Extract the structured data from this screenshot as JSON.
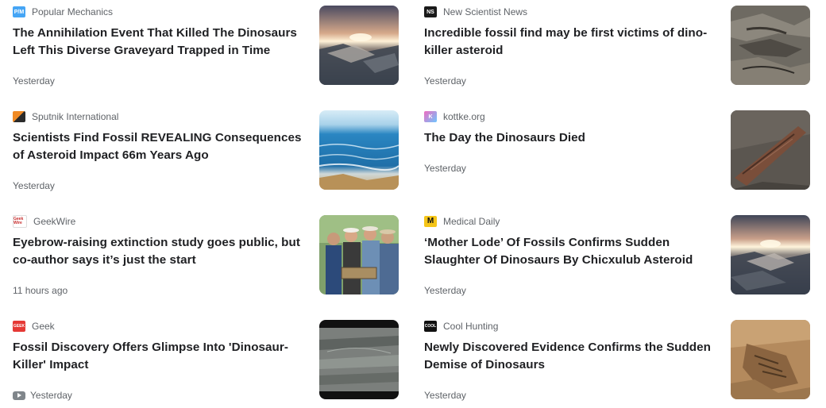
{
  "articles": [
    {
      "source": "Popular Mechanics",
      "logo_text": "P/M",
      "logo_color": "#45a5f5",
      "title": "The Annihilation Event That Killed The Dinosaurs Left This Diverse Graveyard Trapped in Time",
      "time": "Yesterday",
      "thumb": "sunset-ruins-thumbnail"
    },
    {
      "source": "New Scientist News",
      "logo_text": "NS",
      "logo_color": "#1a1a1a",
      "title": "Incredible fossil find may be first victims of dino-killer asteroid",
      "time": "Yesterday",
      "thumb": "fossil-fish-thumbnail"
    },
    {
      "source": "Sputnik International",
      "logo_text": "",
      "logo_color": "#e8622a",
      "title": "Scientists Find Fossil REVEALING Consequences of Asteroid Impact 66m Years Ago",
      "time": "Yesterday",
      "thumb": "ocean-wave-thumbnail"
    },
    {
      "source": "kottke.org",
      "logo_text": "K",
      "logo_color": "#e870c0",
      "title": "The Day the Dinosaurs Died",
      "time": "Yesterday",
      "thumb": "fossil-fin-thumbnail"
    },
    {
      "source": "GeekWire",
      "logo_text": "Geek Wire",
      "logo_color": "#ffffff",
      "title": "Eyebrow-raising extinction study goes public, but co-author says it’s just the start",
      "time": "11 hours ago",
      "thumb": "researchers-photo-thumbnail"
    },
    {
      "source": "Medical Daily",
      "logo_text": "M",
      "logo_color": "#f5c518",
      "title": "‘Mother Lode’ Of Fossils Confirms Sudden Slaughter Of Dinosaurs By Chicxulub Asteroid",
      "time": "Yesterday",
      "thumb": "sunset-ruins-thumbnail-2"
    },
    {
      "source": "Geek",
      "logo_text": "GEEK",
      "logo_color": "#e53935",
      "title": "Fossil Discovery Offers Glimpse Into 'Dinosaur-Killer' Impact",
      "time": "Yesterday",
      "time_icon": "youtube-icon",
      "thumb": "rock-layers-video-thumbnail"
    },
    {
      "source": "Cool Hunting",
      "logo_text": "COOL",
      "logo_color": "#111111",
      "title": "Newly Discovered Evidence Confirms the Sudden Demise of Dinosaurs",
      "time": "Yesterday",
      "thumb": "fossil-rock-thumbnail"
    }
  ]
}
